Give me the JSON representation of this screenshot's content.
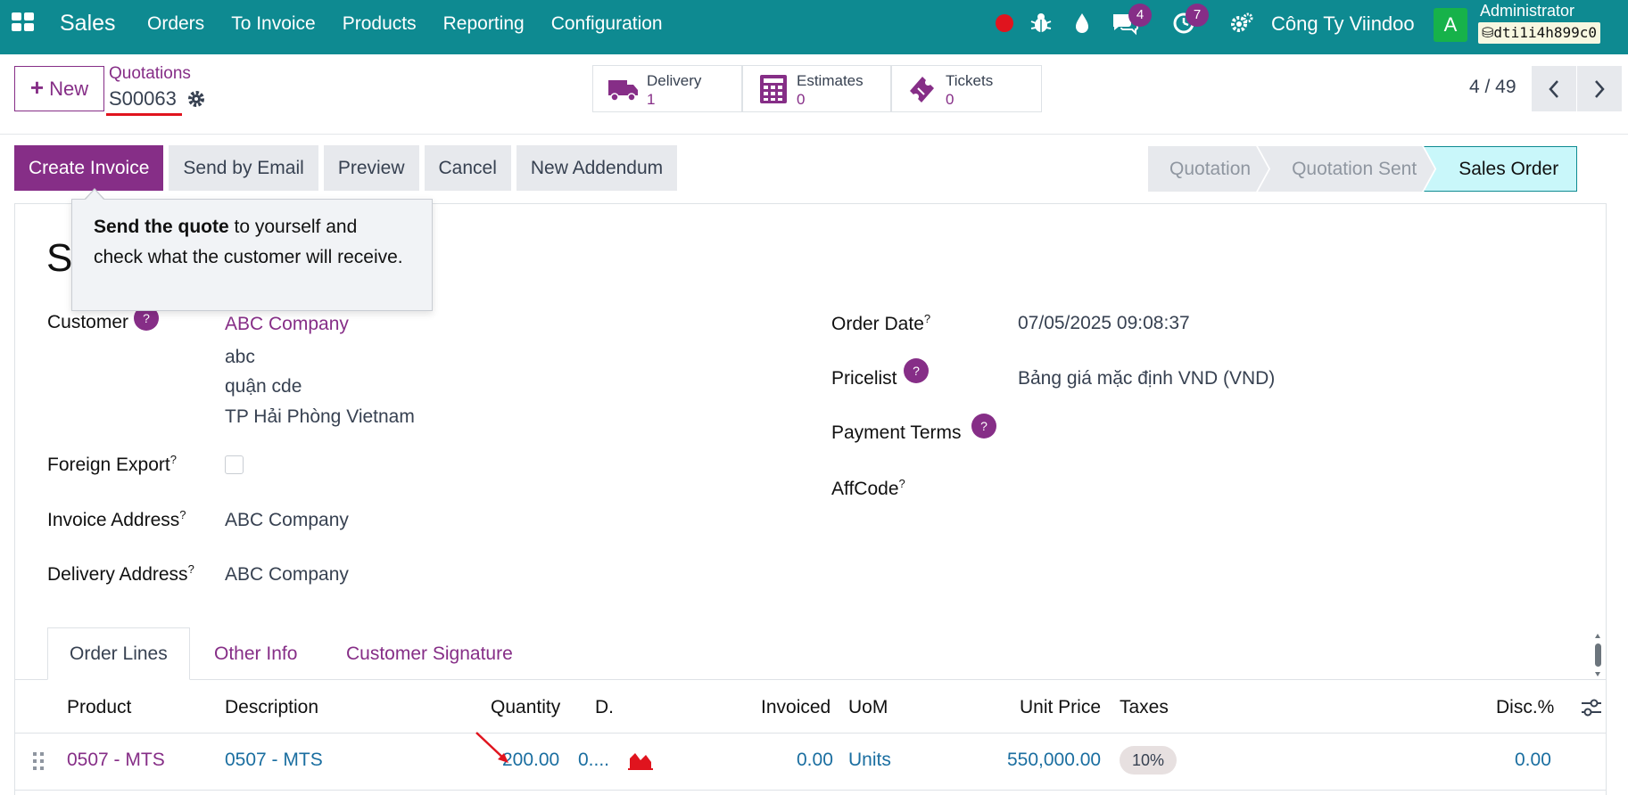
{
  "navbar": {
    "brand": "Sales",
    "menu": [
      "Orders",
      "To Invoice",
      "Products",
      "Reporting",
      "Configuration"
    ],
    "messages_badge": "4",
    "activities_badge": "7",
    "company": "Công Ty Viindoo",
    "avatar_letter": "A",
    "user": "Administrator",
    "database": "dti1i4h899c0",
    "colors": {
      "bar": "#0e8a91",
      "accent": "#862e87",
      "record": "#e0141e",
      "avatar": "#17b24a"
    }
  },
  "control": {
    "new_label": "New",
    "breadcrumb_parent": "Quotations",
    "breadcrumb_current": "S00063",
    "smart_buttons": [
      {
        "label": "Delivery",
        "value": "1",
        "icon": "truck-icon"
      },
      {
        "label": "Estimates",
        "value": "0",
        "icon": "calculator-icon"
      },
      {
        "label": "Tickets",
        "value": "0",
        "icon": "ticket-icon"
      }
    ],
    "pager": "4 / 49"
  },
  "actions": [
    "Create Invoice",
    "Send by Email",
    "Preview",
    "Cancel",
    "New Addendum"
  ],
  "stages": [
    "Quotation",
    "Quotation Sent",
    "Sales Order"
  ],
  "active_stage": "Sales Order",
  "tooltip": {
    "bold": "Send the quote",
    "rest": " to yourself and check what the customer will receive."
  },
  "form": {
    "title_partial": "S",
    "customer_label": "Customer",
    "customer_name": "ABC Company",
    "customer_address": [
      "abc",
      "quận cde",
      "TP Hải Phòng Vietnam"
    ],
    "foreign_export_label": "Foreign Export",
    "invoice_address_label": "Invoice Address",
    "invoice_address": "ABC Company",
    "delivery_address_label": "Delivery Address",
    "delivery_address": "ABC Company",
    "order_date_label": "Order Date",
    "order_date": "07/05/2025 09:08:37",
    "pricelist_label": "Pricelist",
    "pricelist": "Bảng giá mặc định VND (VND)",
    "payment_terms_label": "Payment Terms",
    "affcode_label": "AffCode",
    "help_mark": "?"
  },
  "tabs": [
    "Order Lines",
    "Other Info",
    "Customer Signature"
  ],
  "table": {
    "headers": [
      "Product",
      "Description",
      "Quantity",
      "D.",
      "Invoiced",
      "UoM",
      "Unit Price",
      "Taxes",
      "Disc.%"
    ],
    "rows": [
      {
        "product": "0507 - MTS",
        "description": "0507 - MTS",
        "quantity": "200.00",
        "delivered": "0....",
        "invoiced": "0.00",
        "uom": "Units",
        "unit_price": "550,000.00",
        "taxes": "10%",
        "discount": "0.00"
      }
    ]
  }
}
